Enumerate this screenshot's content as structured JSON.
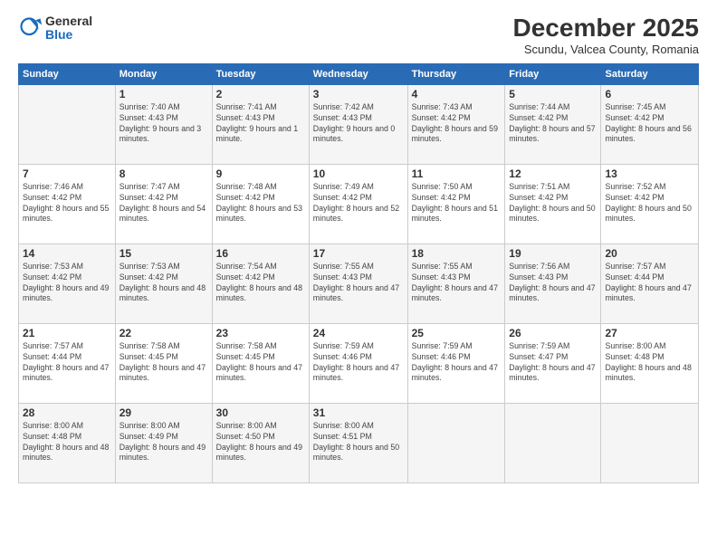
{
  "logo": {
    "general": "General",
    "blue": "Blue"
  },
  "title": "December 2025",
  "subtitle": "Scundu, Valcea County, Romania",
  "days_of_week": [
    "Sunday",
    "Monday",
    "Tuesday",
    "Wednesday",
    "Thursday",
    "Friday",
    "Saturday"
  ],
  "weeks": [
    [
      {
        "day": "",
        "sunrise": "",
        "sunset": "",
        "daylight": ""
      },
      {
        "day": "1",
        "sunrise": "Sunrise: 7:40 AM",
        "sunset": "Sunset: 4:43 PM",
        "daylight": "Daylight: 9 hours and 3 minutes."
      },
      {
        "day": "2",
        "sunrise": "Sunrise: 7:41 AM",
        "sunset": "Sunset: 4:43 PM",
        "daylight": "Daylight: 9 hours and 1 minute."
      },
      {
        "day": "3",
        "sunrise": "Sunrise: 7:42 AM",
        "sunset": "Sunset: 4:43 PM",
        "daylight": "Daylight: 9 hours and 0 minutes."
      },
      {
        "day": "4",
        "sunrise": "Sunrise: 7:43 AM",
        "sunset": "Sunset: 4:42 PM",
        "daylight": "Daylight: 8 hours and 59 minutes."
      },
      {
        "day": "5",
        "sunrise": "Sunrise: 7:44 AM",
        "sunset": "Sunset: 4:42 PM",
        "daylight": "Daylight: 8 hours and 57 minutes."
      },
      {
        "day": "6",
        "sunrise": "Sunrise: 7:45 AM",
        "sunset": "Sunset: 4:42 PM",
        "daylight": "Daylight: 8 hours and 56 minutes."
      }
    ],
    [
      {
        "day": "7",
        "sunrise": "Sunrise: 7:46 AM",
        "sunset": "Sunset: 4:42 PM",
        "daylight": "Daylight: 8 hours and 55 minutes."
      },
      {
        "day": "8",
        "sunrise": "Sunrise: 7:47 AM",
        "sunset": "Sunset: 4:42 PM",
        "daylight": "Daylight: 8 hours and 54 minutes."
      },
      {
        "day": "9",
        "sunrise": "Sunrise: 7:48 AM",
        "sunset": "Sunset: 4:42 PM",
        "daylight": "Daylight: 8 hours and 53 minutes."
      },
      {
        "day": "10",
        "sunrise": "Sunrise: 7:49 AM",
        "sunset": "Sunset: 4:42 PM",
        "daylight": "Daylight: 8 hours and 52 minutes."
      },
      {
        "day": "11",
        "sunrise": "Sunrise: 7:50 AM",
        "sunset": "Sunset: 4:42 PM",
        "daylight": "Daylight: 8 hours and 51 minutes."
      },
      {
        "day": "12",
        "sunrise": "Sunrise: 7:51 AM",
        "sunset": "Sunset: 4:42 PM",
        "daylight": "Daylight: 8 hours and 50 minutes."
      },
      {
        "day": "13",
        "sunrise": "Sunrise: 7:52 AM",
        "sunset": "Sunset: 4:42 PM",
        "daylight": "Daylight: 8 hours and 50 minutes."
      }
    ],
    [
      {
        "day": "14",
        "sunrise": "Sunrise: 7:53 AM",
        "sunset": "Sunset: 4:42 PM",
        "daylight": "Daylight: 8 hours and 49 minutes."
      },
      {
        "day": "15",
        "sunrise": "Sunrise: 7:53 AM",
        "sunset": "Sunset: 4:42 PM",
        "daylight": "Daylight: 8 hours and 48 minutes."
      },
      {
        "day": "16",
        "sunrise": "Sunrise: 7:54 AM",
        "sunset": "Sunset: 4:42 PM",
        "daylight": "Daylight: 8 hours and 48 minutes."
      },
      {
        "day": "17",
        "sunrise": "Sunrise: 7:55 AM",
        "sunset": "Sunset: 4:43 PM",
        "daylight": "Daylight: 8 hours and 47 minutes."
      },
      {
        "day": "18",
        "sunrise": "Sunrise: 7:55 AM",
        "sunset": "Sunset: 4:43 PM",
        "daylight": "Daylight: 8 hours and 47 minutes."
      },
      {
        "day": "19",
        "sunrise": "Sunrise: 7:56 AM",
        "sunset": "Sunset: 4:43 PM",
        "daylight": "Daylight: 8 hours and 47 minutes."
      },
      {
        "day": "20",
        "sunrise": "Sunrise: 7:57 AM",
        "sunset": "Sunset: 4:44 PM",
        "daylight": "Daylight: 8 hours and 47 minutes."
      }
    ],
    [
      {
        "day": "21",
        "sunrise": "Sunrise: 7:57 AM",
        "sunset": "Sunset: 4:44 PM",
        "daylight": "Daylight: 8 hours and 47 minutes."
      },
      {
        "day": "22",
        "sunrise": "Sunrise: 7:58 AM",
        "sunset": "Sunset: 4:45 PM",
        "daylight": "Daylight: 8 hours and 47 minutes."
      },
      {
        "day": "23",
        "sunrise": "Sunrise: 7:58 AM",
        "sunset": "Sunset: 4:45 PM",
        "daylight": "Daylight: 8 hours and 47 minutes."
      },
      {
        "day": "24",
        "sunrise": "Sunrise: 7:59 AM",
        "sunset": "Sunset: 4:46 PM",
        "daylight": "Daylight: 8 hours and 47 minutes."
      },
      {
        "day": "25",
        "sunrise": "Sunrise: 7:59 AM",
        "sunset": "Sunset: 4:46 PM",
        "daylight": "Daylight: 8 hours and 47 minutes."
      },
      {
        "day": "26",
        "sunrise": "Sunrise: 7:59 AM",
        "sunset": "Sunset: 4:47 PM",
        "daylight": "Daylight: 8 hours and 47 minutes."
      },
      {
        "day": "27",
        "sunrise": "Sunrise: 8:00 AM",
        "sunset": "Sunset: 4:48 PM",
        "daylight": "Daylight: 8 hours and 48 minutes."
      }
    ],
    [
      {
        "day": "28",
        "sunrise": "Sunrise: 8:00 AM",
        "sunset": "Sunset: 4:48 PM",
        "daylight": "Daylight: 8 hours and 48 minutes."
      },
      {
        "day": "29",
        "sunrise": "Sunrise: 8:00 AM",
        "sunset": "Sunset: 4:49 PM",
        "daylight": "Daylight: 8 hours and 49 minutes."
      },
      {
        "day": "30",
        "sunrise": "Sunrise: 8:00 AM",
        "sunset": "Sunset: 4:50 PM",
        "daylight": "Daylight: 8 hours and 49 minutes."
      },
      {
        "day": "31",
        "sunrise": "Sunrise: 8:00 AM",
        "sunset": "Sunset: 4:51 PM",
        "daylight": "Daylight: 8 hours and 50 minutes."
      },
      {
        "day": "",
        "sunrise": "",
        "sunset": "",
        "daylight": ""
      },
      {
        "day": "",
        "sunrise": "",
        "sunset": "",
        "daylight": ""
      },
      {
        "day": "",
        "sunrise": "",
        "sunset": "",
        "daylight": ""
      }
    ]
  ]
}
